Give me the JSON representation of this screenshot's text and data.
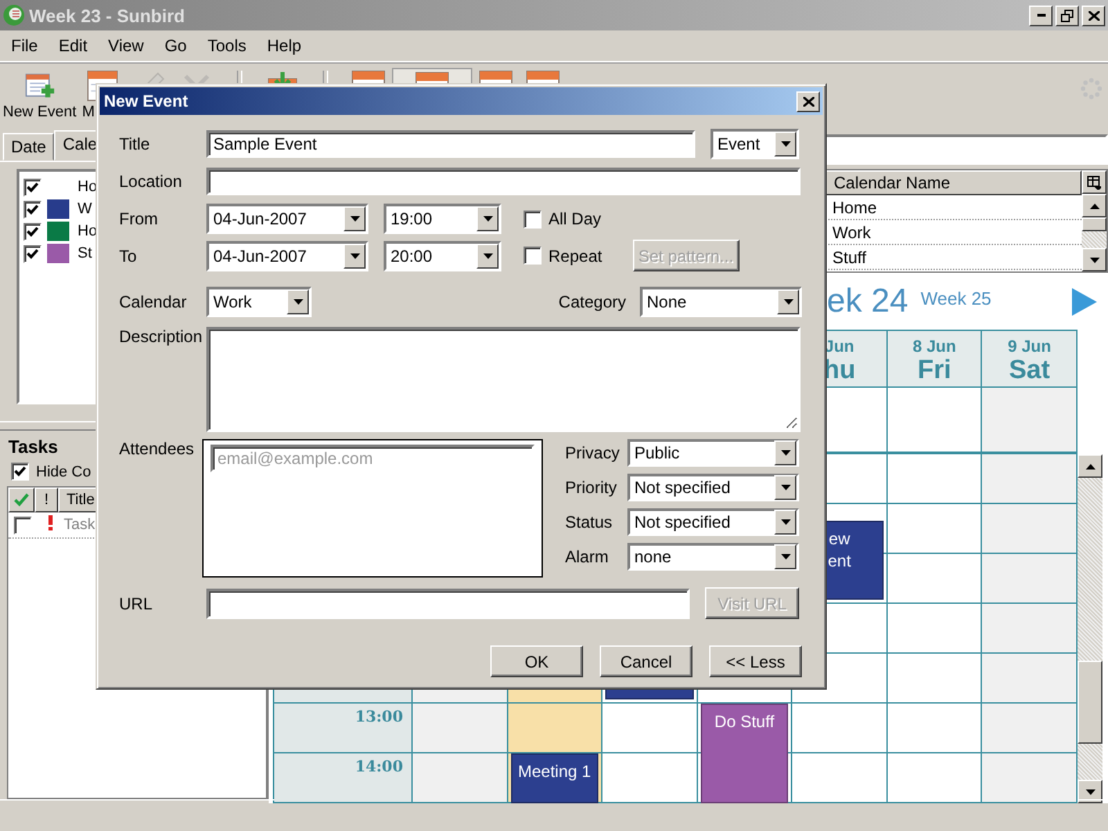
{
  "window": {
    "title": "Week 23 - Sunbird"
  },
  "menu": [
    "File",
    "Edit",
    "View",
    "Go",
    "Tools",
    "Help"
  ],
  "toolbar": [
    {
      "kind": "new-event",
      "label": "New Event",
      "selected": false,
      "disabled": false
    },
    {
      "kind": "calendar",
      "label": "M",
      "selected": false,
      "disabled": false
    },
    {
      "kind": "edit",
      "selected": false,
      "disabled": true
    },
    {
      "kind": "delete",
      "selected": false,
      "disabled": true
    },
    {
      "kind": "separator"
    },
    {
      "kind": "download",
      "selected": false,
      "disabled": false
    },
    {
      "kind": "separator"
    },
    {
      "kind": "calendar",
      "selected": false,
      "disabled": false
    },
    {
      "kind": "calendar",
      "selected": true,
      "disabled": false
    },
    {
      "kind": "calendar",
      "selected": false,
      "disabled": false
    },
    {
      "kind": "calendar",
      "selected": false,
      "disabled": false
    }
  ],
  "side_tabs": [
    {
      "label": "Date",
      "selected": false
    },
    {
      "label": "Cale",
      "selected": true
    }
  ],
  "calendars": [
    {
      "name": "Ho",
      "checked": true
    },
    {
      "name": "W",
      "checked": true,
      "color": "#283c8c"
    },
    {
      "name": "Ho",
      "checked": true,
      "color": "#0a7a46"
    },
    {
      "name": "St",
      "checked": true,
      "color": "#9a5aa8"
    }
  ],
  "tasks": {
    "title": "Tasks",
    "hide_completed": {
      "label": "Hide Co",
      "checked": true
    },
    "columns": [
      "!",
      "Title"
    ],
    "rows": [
      {
        "title": "Task",
        "done": false
      }
    ]
  },
  "calendar_list": {
    "column": "Calendar Name",
    "rows": [
      "Home",
      "Work",
      "Stuff"
    ]
  },
  "week_nav": {
    "current": "ek 24",
    "next": "Week 25"
  },
  "days": [
    {
      "weekend": true,
      "today": false
    },
    {
      "weekend": false,
      "today": true,
      "events": [
        {
          "color": "#2c3f8f",
          "lines": [
            "Meeting 1"
          ]
        }
      ]
    },
    {
      "weekend": false,
      "today": false,
      "events": [
        {
          "color": "#2c3f8f"
        }
      ]
    },
    {
      "weekend": false,
      "today": false,
      "events": [
        {
          "color": "#9a5aa8",
          "lines": [
            "Do Stuff"
          ]
        }
      ]
    },
    {
      "date": "Jun",
      "day": "hu",
      "weekend": false,
      "today": false,
      "events": [
        {
          "color": "#2c3f8f",
          "lines": [
            "ew",
            "ent"
          ]
        }
      ]
    },
    {
      "date": "8 Jun",
      "day": "Fri",
      "weekend": false,
      "today": false
    },
    {
      "date": "9 Jun",
      "day": "Sat",
      "weekend": true,
      "today": false
    }
  ],
  "hours": [
    "13:00",
    "14:00"
  ],
  "dialog": {
    "title": "New Event",
    "title_label": "Title",
    "title_value": "Sample Event",
    "type": "Event",
    "location_label": "Location",
    "from_label": "From",
    "from_date": "04-Jun-2007",
    "from_time": "19:00",
    "all_day": {
      "label": "All Day",
      "checked": false
    },
    "to_label": "To",
    "to_date": "04-Jun-2007",
    "to_time": "20:00",
    "repeat": {
      "label": "Repeat",
      "checked": false
    },
    "set_pattern": {
      "label": "Set pattern...",
      "disabled": true
    },
    "calendar_label": "Calendar",
    "calendar": "Work",
    "category_label": "Category",
    "category": "None",
    "description_label": "Description",
    "attendees_label": "Attendees",
    "attendee_placeholder": "email@example.com",
    "selects": [
      {
        "label": "Privacy",
        "value": "Public"
      },
      {
        "label": "Priority",
        "value": "Not specified"
      },
      {
        "label": "Status",
        "value": "Not specified"
      },
      {
        "label": "Alarm",
        "value": "none"
      }
    ],
    "url_label": "URL",
    "visit_url": {
      "label": "Visit URL",
      "disabled": true
    },
    "buttons": [
      "OK",
      "Cancel",
      "<< Less"
    ]
  }
}
